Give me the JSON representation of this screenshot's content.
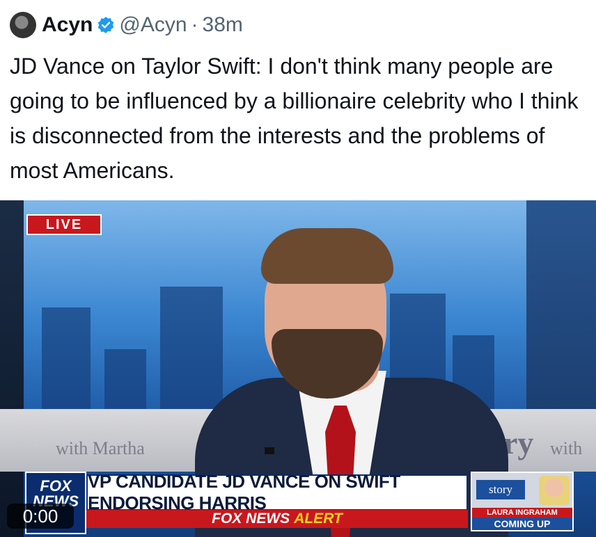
{
  "tweet": {
    "author_name": "Acyn",
    "handle": "@Acyn",
    "separator": "·",
    "time": "38m",
    "text": "JD Vance on Taylor Swift: I don't think many people are going to be influenced by a billionaire celebrity who I think is disconnected from the interests and the problems of most Americans."
  },
  "video": {
    "live_badge": "LIVE",
    "background_text_left": "with Martha",
    "background_text_right": "ory",
    "background_text_right2": "with",
    "network_logo": "FOX NEWS",
    "headline": "VP CANDIDATE JD VANCE ON SWIFT ENDORSING HARRIS",
    "alert_prefix": "FOX NEWS",
    "alert_word": "ALERT",
    "promo_show": "story",
    "promo_name": "LAURA INGRAHAM",
    "promo_sub": "COMING UP",
    "timestamp": "0:00",
    "colors": {
      "fox_blue": "#0b2d6e",
      "alert_red": "#c8181e",
      "alert_yellow": "#ffd21e"
    }
  }
}
